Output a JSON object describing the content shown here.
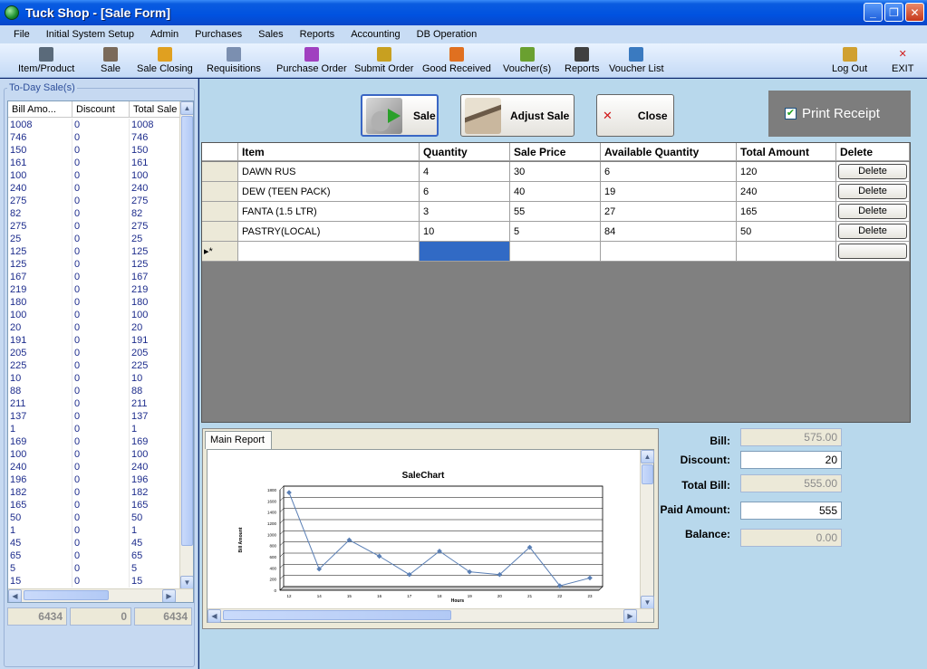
{
  "window": {
    "title": "Tuck Shop - [Sale Form]"
  },
  "menu": [
    "File",
    "Initial System Setup",
    "Admin",
    "Purchases",
    "Sales",
    "Reports",
    "Accounting",
    "DB Operation"
  ],
  "toolbar": [
    {
      "label": "Item/Product",
      "icon": "item-product-icon",
      "color": "#5a6a7a"
    },
    {
      "label": "Sale",
      "icon": "sale-icon",
      "color": "#7a6a5a"
    },
    {
      "label": "Sale Closing",
      "icon": "sale-closing-icon",
      "color": "#e0a020"
    },
    {
      "label": "Requisitions",
      "icon": "requisitions-icon",
      "color": "#7b8fb0"
    },
    {
      "label": "Purchase Order",
      "icon": "purchase-order-icon",
      "color": "#a040c0"
    },
    {
      "label": "Submit Order",
      "icon": "submit-order-icon",
      "color": "#c8a020"
    },
    {
      "label": "Good Received",
      "icon": "good-received-icon",
      "color": "#e07020"
    },
    {
      "label": "Voucher(s)",
      "icon": "vouchers-icon",
      "color": "#6aa030"
    },
    {
      "label": "Reports",
      "icon": "reports-icon",
      "color": "#404040"
    },
    {
      "label": "Voucher List",
      "icon": "voucher-list-icon",
      "color": "#3a7ac0"
    },
    {
      "label": "Log Out",
      "icon": "log-out-icon",
      "color": "#d0a030"
    },
    {
      "label": "EXIT",
      "icon": "exit-icon",
      "color": "#d02020"
    }
  ],
  "today_sales": {
    "title": "To-Day Sale(s)",
    "columns": [
      "Bill Amo...",
      "Discount",
      "Total Sale"
    ],
    "rows": [
      [
        "1008",
        "0",
        "1008"
      ],
      [
        "746",
        "0",
        "746"
      ],
      [
        "150",
        "0",
        "150"
      ],
      [
        "161",
        "0",
        "161"
      ],
      [
        "100",
        "0",
        "100"
      ],
      [
        "240",
        "0",
        "240"
      ],
      [
        "275",
        "0",
        "275"
      ],
      [
        "82",
        "0",
        "82"
      ],
      [
        "275",
        "0",
        "275"
      ],
      [
        "25",
        "0",
        "25"
      ],
      [
        "125",
        "0",
        "125"
      ],
      [
        "125",
        "0",
        "125"
      ],
      [
        "167",
        "0",
        "167"
      ],
      [
        "219",
        "0",
        "219"
      ],
      [
        "180",
        "0",
        "180"
      ],
      [
        "100",
        "0",
        "100"
      ],
      [
        "20",
        "0",
        "20"
      ],
      [
        "191",
        "0",
        "191"
      ],
      [
        "205",
        "0",
        "205"
      ],
      [
        "225",
        "0",
        "225"
      ],
      [
        "10",
        "0",
        "10"
      ],
      [
        "88",
        "0",
        "88"
      ],
      [
        "211",
        "0",
        "211"
      ],
      [
        "137",
        "0",
        "137"
      ],
      [
        "1",
        "0",
        "1"
      ],
      [
        "169",
        "0",
        "169"
      ],
      [
        "100",
        "0",
        "100"
      ],
      [
        "240",
        "0",
        "240"
      ],
      [
        "196",
        "0",
        "196"
      ],
      [
        "182",
        "0",
        "182"
      ],
      [
        "165",
        "0",
        "165"
      ],
      [
        "50",
        "0",
        "50"
      ],
      [
        "1",
        "0",
        "1"
      ],
      [
        "45",
        "0",
        "45"
      ],
      [
        "65",
        "0",
        "65"
      ],
      [
        "5",
        "0",
        "5"
      ],
      [
        "15",
        "0",
        "15"
      ]
    ],
    "totals": [
      "6434",
      "0",
      "6434"
    ]
  },
  "actions": {
    "sale": "Sale",
    "adjust": "Adjust Sale",
    "close": "Close",
    "print_receipt": "Print Receipt"
  },
  "sale_grid": {
    "columns": [
      "Item",
      "Quantity",
      "Sale Price",
      "Available Quantity",
      "Total Amount",
      "Delete"
    ],
    "rows": [
      [
        "DAWN RUS",
        "4",
        "30",
        "6",
        "120"
      ],
      [
        "DEW (TEEN PACK)",
        "6",
        "40",
        "19",
        "240"
      ],
      [
        "FANTA (1.5 LTR)",
        "3",
        "55",
        "27",
        "165"
      ],
      [
        "PASTRY(LOCAL)",
        "10",
        "5",
        "84",
        "50"
      ]
    ],
    "delete_label": "Delete",
    "new_row_marker": "▸*"
  },
  "report": {
    "tab": "Main Report",
    "chart_data": {
      "type": "line",
      "title": "SaleChart",
      "xlabel": "Hours",
      "ylabel": "Bill Amount",
      "x": [
        12,
        13,
        14,
        15,
        16,
        17,
        18,
        19,
        20,
        21,
        22,
        23
      ],
      "x_ticks": [
        "12",
        "14",
        "15",
        "16",
        "17",
        "18",
        "19",
        "20",
        "21",
        "22",
        "23"
      ],
      "values": [
        1750,
        380,
        900,
        610,
        280,
        700,
        330,
        280,
        770,
        80,
        220
      ],
      "y_ticks": [
        "0",
        "200",
        "400",
        "600",
        "800",
        "1000",
        "1200",
        "1400",
        "1600",
        "1800"
      ],
      "ylim": [
        0,
        1800
      ],
      "line_color": "#5a7fb5",
      "grid": true
    }
  },
  "bill": {
    "bill_label": "Bill:",
    "bill_value": "575.00",
    "discount_label": "Discount:",
    "discount_value": "20",
    "total_label": "Total Bill:",
    "total_value": "555.00",
    "paid_label": "Paid Amount:",
    "paid_value": "555",
    "balance_label": "Balance:",
    "balance_value": "0.00"
  }
}
